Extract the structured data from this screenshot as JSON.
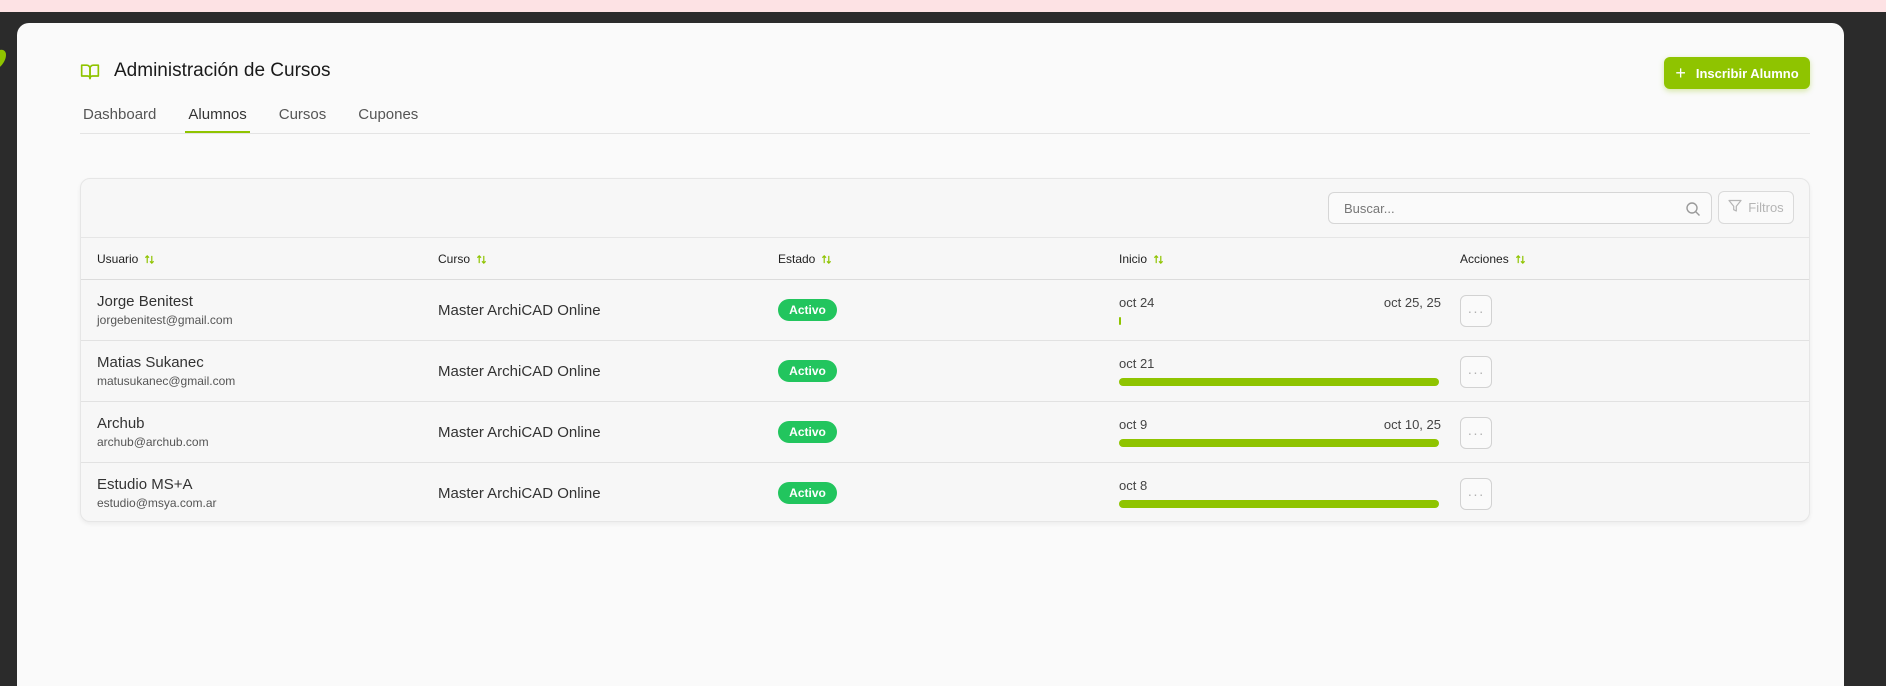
{
  "header": {
    "title": "Administración de Cursos",
    "cta_label": "Inscribir Alumno",
    "book_icon": "book-open-icon"
  },
  "tabs": [
    {
      "label": "Dashboard",
      "active": false
    },
    {
      "label": "Alumnos",
      "active": true
    },
    {
      "label": "Cursos",
      "active": false
    },
    {
      "label": "Cupones",
      "active": false
    }
  ],
  "toolbar": {
    "search_placeholder": "Buscar...",
    "filters_label": "Filtros"
  },
  "table": {
    "columns": [
      "Usuario",
      "Curso",
      "Estado",
      "Inicio",
      "Acciones"
    ],
    "rows": [
      {
        "name": "Jorge Benitest",
        "email": "jorgebenitest@gmail.com",
        "course": "Master ArchiCAD Online",
        "status": "Activo",
        "start": "oct 24",
        "end": "oct 25, 25",
        "progress": 0.01
      },
      {
        "name": "Matias Sukanec",
        "email": "matusukanec@gmail.com",
        "course": "Master ArchiCAD Online",
        "status": "Activo",
        "start": "oct 21",
        "end": "",
        "progress": 1.0
      },
      {
        "name": "Archub",
        "email": "archub@archub.com",
        "course": "Master ArchiCAD Online",
        "status": "Activo",
        "start": "oct 9",
        "end": "oct 10, 25",
        "progress": 1.0
      },
      {
        "name": "Estudio MS+A",
        "email": "estudio@msya.com.ar",
        "course": "Master ArchiCAD Online",
        "status": "Activo",
        "start": "oct 8",
        "end": "",
        "progress": 1.0
      }
    ]
  },
  "colors": {
    "accent": "#8fc400",
    "status_active": "#22c55e"
  }
}
